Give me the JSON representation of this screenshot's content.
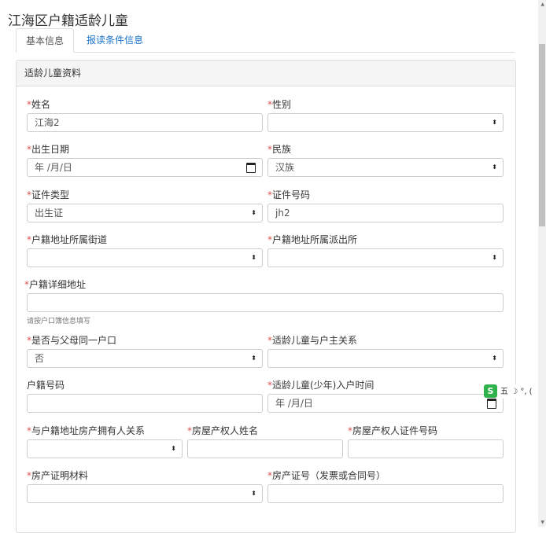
{
  "page": {
    "title": "江海区户籍适龄儿童"
  },
  "tabs": [
    {
      "label": "基本信息"
    },
    {
      "label": "报读条件信息"
    }
  ],
  "panel": {
    "title": "适龄儿童资料"
  },
  "req_mark": "*",
  "fields": {
    "name": {
      "label": "姓名",
      "value": "江海2"
    },
    "gender": {
      "label": "性别",
      "value": ""
    },
    "birth_date": {
      "label": "出生日期",
      "value": "年 /月/日"
    },
    "ethnicity": {
      "label": "民族",
      "value": "汉族"
    },
    "id_type": {
      "label": "证件类型",
      "value": "出生证"
    },
    "id_number": {
      "label": "证件号码",
      "value": "jh2"
    },
    "street": {
      "label": "户籍地址所属街道",
      "value": ""
    },
    "police_station": {
      "label": "户籍地址所属派出所",
      "value": ""
    },
    "address": {
      "label": "户籍详细地址",
      "value": "",
      "help": "请按户口簿信息填写"
    },
    "same_household": {
      "label": "是否与父母同一户口",
      "value": "否"
    },
    "relation_to_head": {
      "label": "适龄儿童与户主关系",
      "value": ""
    },
    "household_number": {
      "label": "户籍号码",
      "value": ""
    },
    "registration_date": {
      "label": "适龄儿童(少年)入户时间",
      "value": "年 /月/日"
    },
    "relation_to_owner": {
      "label": "与户籍地址房产拥有人关系",
      "value": ""
    },
    "owner_name": {
      "label": "房屋产权人姓名",
      "value": ""
    },
    "owner_id": {
      "label": "房屋产权人证件号码",
      "value": ""
    },
    "property_doc": {
      "label": "房产证明材料",
      "value": ""
    },
    "property_cert_no": {
      "label": "房产证号（发票或合同号）",
      "value": ""
    }
  },
  "icons": {
    "select_caret": "⬍",
    "calendar": "calendar-icon"
  },
  "ime": {
    "logo": "S",
    "text": "五 ☽ °, ("
  }
}
